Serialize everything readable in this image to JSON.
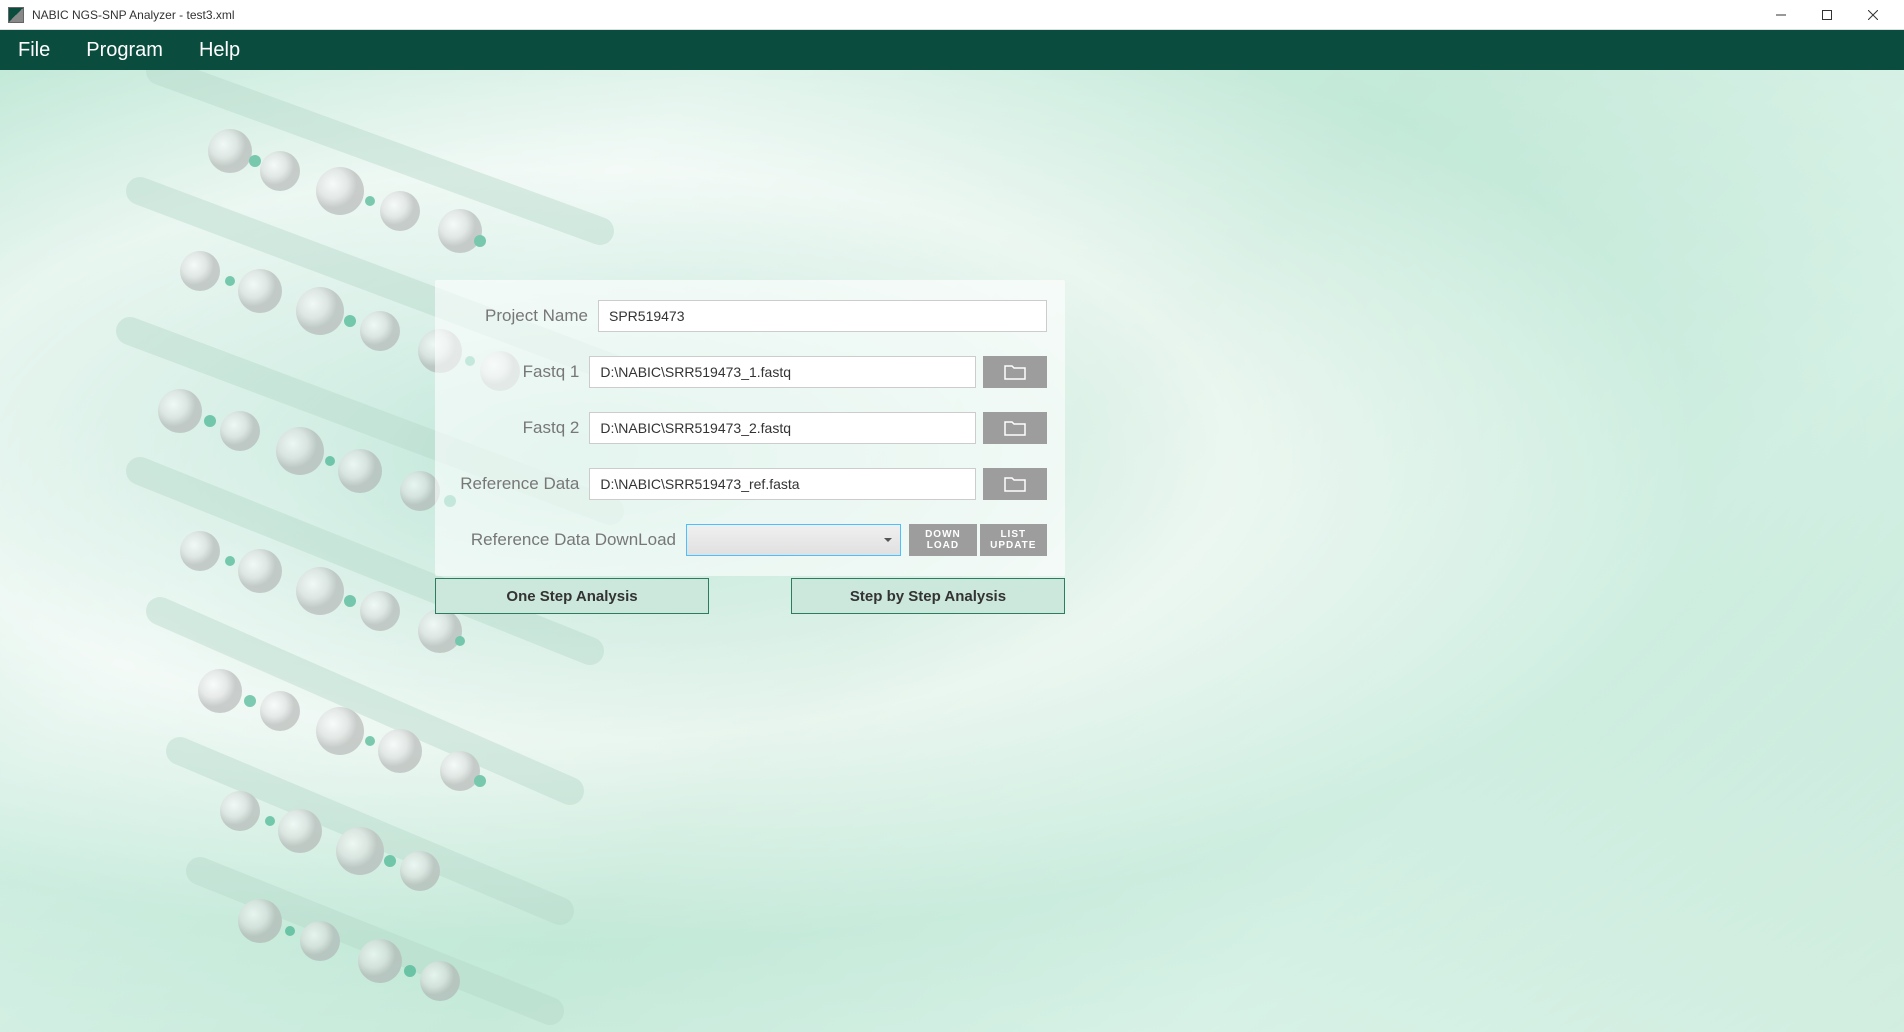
{
  "window": {
    "title": "NABIC NGS-SNP Analyzer - test3.xml"
  },
  "menubar": {
    "items": [
      "File",
      "Program",
      "Help"
    ]
  },
  "form": {
    "project_name_label": "Project Name",
    "project_name_value": "SPR519473",
    "fastq1_label": "Fastq 1",
    "fastq1_value": "D:\\NABIC\\SRR519473_1.fastq",
    "fastq2_label": "Fastq 2",
    "fastq2_value": "D:\\NABIC\\SRR519473_2.fastq",
    "refdata_label": "Reference Data",
    "refdata_value": "D:\\NABIC\\SRR519473_ref.fasta",
    "refdl_label": "Reference Data DownLoad",
    "download_btn": "DOWN\nLOAD",
    "listupdate_btn": "LIST\nUPDATE"
  },
  "actions": {
    "one_step": "One Step Analysis",
    "step_by_step": "Step by Step Analysis"
  }
}
